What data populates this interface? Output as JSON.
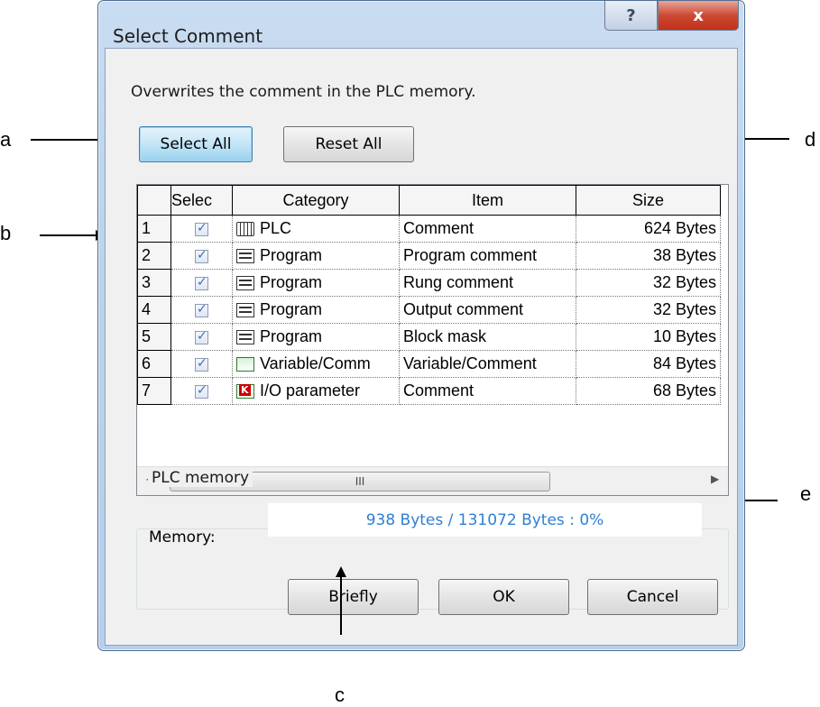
{
  "window": {
    "title": "Select Comment",
    "help_glyph": "?",
    "close_glyph": "x"
  },
  "message": "Overwrites the comment in the PLC memory.",
  "buttons": {
    "select_all": "Select All",
    "reset_all": "Reset All",
    "briefly": "Briefly",
    "ok": "OK",
    "cancel": "Cancel"
  },
  "grid": {
    "headers": [
      "",
      "Selec",
      "Category",
      "Item",
      "Size"
    ],
    "rows": [
      {
        "num": "1",
        "checked": true,
        "icon": "plc-icon",
        "category": "PLC",
        "item": "Comment",
        "size": "624 Bytes"
      },
      {
        "num": "2",
        "checked": true,
        "icon": "program-icon",
        "category": "Program",
        "item": "Program comment",
        "size": "38 Bytes"
      },
      {
        "num": "3",
        "checked": true,
        "icon": "program-icon",
        "category": "Program",
        "item": "Rung comment",
        "size": "32 Bytes"
      },
      {
        "num": "4",
        "checked": true,
        "icon": "program-icon",
        "category": "Program",
        "item": "Output comment",
        "size": "32 Bytes"
      },
      {
        "num": "5",
        "checked": true,
        "icon": "program-icon",
        "category": "Program",
        "item": "Block mask",
        "size": "10 Bytes"
      },
      {
        "num": "6",
        "checked": true,
        "icon": "variable-comment-icon",
        "category": "Variable/Comm",
        "item": "Variable/Comment",
        "size": "84 Bytes"
      },
      {
        "num": "7",
        "checked": true,
        "icon": "io-parameter-icon",
        "category": "I/O parameter",
        "item": "Comment",
        "size": "68 Bytes"
      }
    ],
    "scrollbar_thumb_glyph": "III"
  },
  "plc_memory": {
    "group_label": "PLC memory",
    "memory_label": "Memory:",
    "memory_value": "938 Bytes / 131072 Bytes : 0%"
  },
  "callouts": {
    "a": "a",
    "b": "b",
    "c": "c",
    "d": "d",
    "e": "e"
  }
}
